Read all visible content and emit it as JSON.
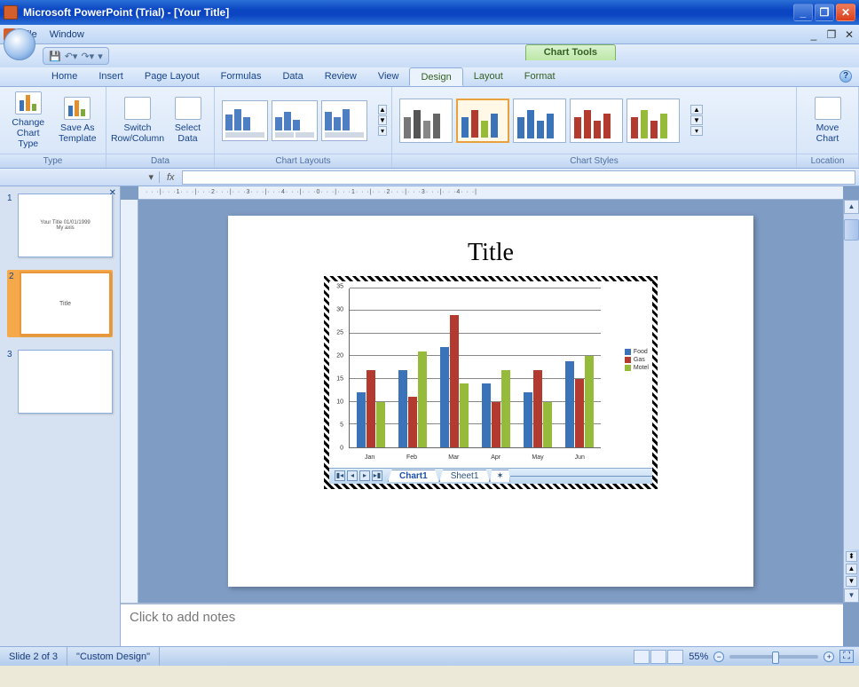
{
  "window": {
    "title": "Microsoft PowerPoint (Trial) - [Your Title]"
  },
  "menu": {
    "file": "File",
    "window": "Window"
  },
  "chart_tools_label": "Chart Tools",
  "tabs": {
    "home": "Home",
    "insert": "Insert",
    "page_layout": "Page Layout",
    "formulas": "Formulas",
    "data": "Data",
    "review": "Review",
    "view": "View",
    "design": "Design",
    "layout": "Layout",
    "format": "Format"
  },
  "ribbon": {
    "type_group": "Type",
    "change_chart_type": "Change Chart Type",
    "save_as_template": "Save As Template",
    "data_group": "Data",
    "switch_row_col": "Switch Row/Column",
    "select_data": "Select Data",
    "layouts_group": "Chart Layouts",
    "styles_group": "Chart Styles",
    "location_group": "Location",
    "move_chart": "Move Chart"
  },
  "formula_bar": {
    "fx": "fx"
  },
  "thumbs": {
    "1": {
      "line1": "Your Title 01/01/1999",
      "line2": "My axis"
    },
    "2": {
      "line1": "Title"
    },
    "3": {
      "line1": ""
    }
  },
  "slide": {
    "title": "Title",
    "sheet_tabs": {
      "chart": "Chart1",
      "sheet": "Sheet1"
    }
  },
  "notes_placeholder": "Click to add notes",
  "status": {
    "slide": "Slide 2 of 3",
    "theme": "\"Custom Design\"",
    "zoom": "55%"
  },
  "colors": {
    "food": "#3b73b9",
    "gas": "#b33a2f",
    "motel": "#96ba3a"
  },
  "chart_data": {
    "type": "bar",
    "title": "",
    "categories": [
      "Jan",
      "Feb",
      "Mar",
      "Apr",
      "May",
      "Jun"
    ],
    "series": [
      {
        "name": "Food",
        "values": [
          12,
          17,
          22,
          14,
          12,
          19
        ]
      },
      {
        "name": "Gas",
        "values": [
          17,
          11,
          29,
          10,
          17,
          15
        ]
      },
      {
        "name": "Motel",
        "values": [
          10,
          21,
          14,
          17,
          10,
          20
        ]
      }
    ],
    "ylim": [
      0,
      35
    ],
    "yticks": [
      0,
      5,
      10,
      15,
      20,
      25,
      30,
      35
    ],
    "xlabel": "",
    "ylabel": ""
  }
}
